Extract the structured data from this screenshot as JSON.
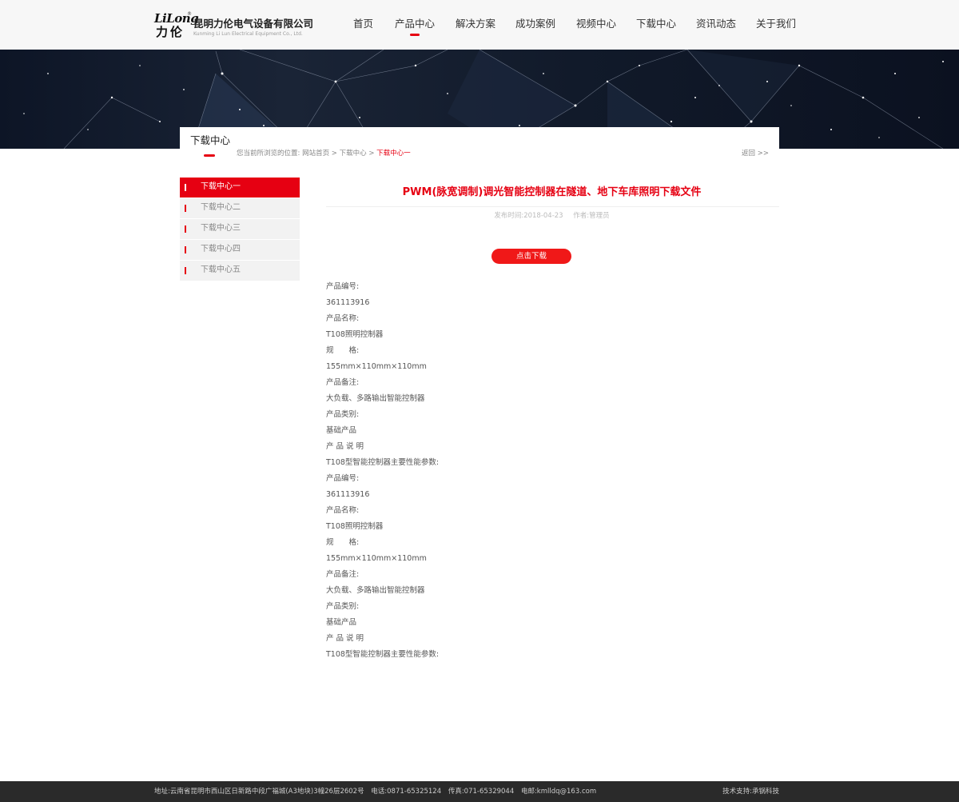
{
  "header": {
    "logo_latin": "LiLong",
    "logo_reg": "®",
    "logo_cn": "力伦",
    "company_cn": "昆明力伦电气设备有限公司",
    "company_en": "Kunming Li Lun Electrical Equipment Co., Ltd.",
    "nav": [
      {
        "label": "首页"
      },
      {
        "label": "产品中心",
        "active": true
      },
      {
        "label": "解决方案"
      },
      {
        "label": "成功案例"
      },
      {
        "label": "视频中心"
      },
      {
        "label": "下载中心"
      },
      {
        "label": "资讯动态"
      },
      {
        "label": "关于我们"
      }
    ]
  },
  "section": {
    "title": "下载中心",
    "breadcrumb_prefix": "您当前所浏览的位置:",
    "breadcrumb": [
      "网站首页",
      "下载中心",
      "下载中心一"
    ],
    "breadcrumb_sep": ">",
    "back": "返回 >>"
  },
  "sidebar": {
    "items": [
      {
        "label": "下载中心一",
        "active": true
      },
      {
        "label": "下载中心二"
      },
      {
        "label": "下载中心三"
      },
      {
        "label": "下载中心四"
      },
      {
        "label": "下载中心五"
      }
    ]
  },
  "article": {
    "title": "PWM(脉宽调制)调光智能控制器在隧道、地下车库照明下载文件",
    "date": "发布时间:2018-04-23",
    "author": "作者:管理员",
    "download_label": "点击下载",
    "lines": [
      "产品编号:",
      "361113916",
      "产品名称:",
      "T108照明控制器",
      "规　　格:",
      "155mm×110mm×110mm",
      "产品备注:",
      "大负载、多路输出智能控制器",
      "产品类别:",
      "基础产品",
      "产 品 说 明",
      "T108型智能控制器主要性能参数:",
      "产品编号:",
      "361113916",
      "产品名称:",
      "T108照明控制器",
      "规　　格:",
      "155mm×110mm×110mm",
      "产品备注:",
      "大负载、多路输出智能控制器",
      "产品类别:",
      "基础产品",
      "产 品 说 明",
      "T108型智能控制器主要性能参数:"
    ]
  },
  "footer": {
    "address": "地址:云南省昆明市西山区日新路中段广福城(A3地块)3幢26层2602号",
    "phone": "电话:0871-65325124",
    "fax": "传真:071-65329044",
    "email": "电邮:kmlldq@163.com",
    "support": "技术支持:承锅科技"
  },
  "colors": {
    "accent": "#e60012",
    "header_bg": "#f7f7f7",
    "footer_bg": "#2a2a2a",
    "sidebar_bg": "#f2f2f2"
  }
}
